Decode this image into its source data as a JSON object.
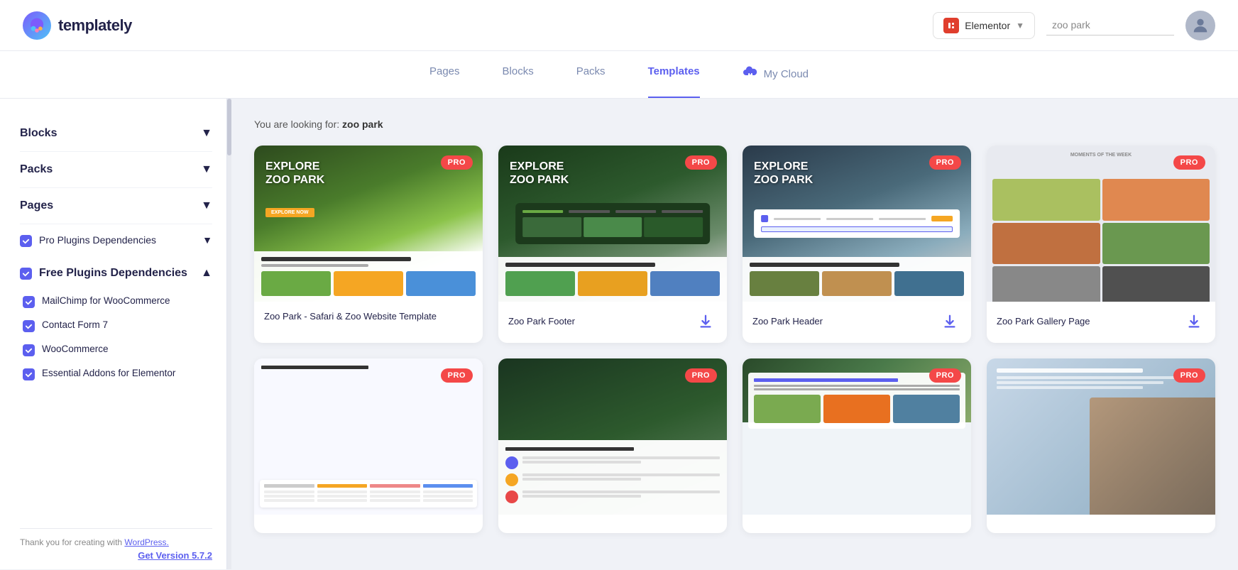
{
  "app": {
    "name": "templately",
    "logo_alt": "Templately logo"
  },
  "header": {
    "builder_label": "Elementor",
    "search_placeholder": "zoo park",
    "search_value": "zoo park"
  },
  "nav": {
    "tabs": [
      {
        "id": "pages",
        "label": "Pages",
        "active": false
      },
      {
        "id": "blocks",
        "label": "Blocks",
        "active": false
      },
      {
        "id": "packs",
        "label": "Packs",
        "active": false
      },
      {
        "id": "templates",
        "label": "Templates",
        "active": true
      },
      {
        "id": "my-cloud",
        "label": "My Cloud",
        "active": false,
        "has_icon": true
      }
    ]
  },
  "sidebar": {
    "filters": [
      {
        "id": "blocks",
        "label": "Blocks",
        "expanded": false
      },
      {
        "id": "packs",
        "label": "Packs",
        "expanded": false
      },
      {
        "id": "pages",
        "label": "Pages",
        "expanded": false
      }
    ],
    "pro_plugins": {
      "label": "Pro Plugins Dependencies",
      "checked": true
    },
    "free_plugins": {
      "label": "Free Plugins Dependencies",
      "checked": true,
      "expanded": true,
      "items": [
        {
          "label": "MailChimp for WooCommerce",
          "checked": true
        },
        {
          "label": "Contact Form 7",
          "checked": true
        },
        {
          "label": "WooCommerce",
          "checked": true
        },
        {
          "label": "Essential Addons for Elementor",
          "checked": true
        }
      ]
    },
    "footer_text": "Thank you for creating with",
    "footer_link_text": "WordPress.",
    "get_version": "Get Version 5.7.2"
  },
  "content": {
    "looking_for_prefix": "You are looking for:",
    "looking_for_query": "zoo park",
    "templates": [
      {
        "id": 1,
        "name": "Zoo Park - Safari & Zoo Website Template",
        "pro": true,
        "has_download": false,
        "thumb_type": "zoo-safari"
      },
      {
        "id": 2,
        "name": "Zoo Park Footer",
        "pro": true,
        "has_download": true,
        "thumb_type": "zoo-footer"
      },
      {
        "id": 3,
        "name": "Zoo Park Header",
        "pro": true,
        "has_download": true,
        "thumb_type": "zoo-header"
      },
      {
        "id": 4,
        "name": "Zoo Park Gallery Page",
        "pro": true,
        "has_download": true,
        "thumb_type": "zoo-gallery"
      },
      {
        "id": 5,
        "name": "",
        "pro": true,
        "has_download": false,
        "thumb_type": "zoo-membership"
      },
      {
        "id": 6,
        "name": "",
        "pro": true,
        "has_download": false,
        "thumb_type": "zoo-tickets"
      },
      {
        "id": 7,
        "name": "",
        "pro": true,
        "has_download": false,
        "thumb_type": "zoo-events"
      },
      {
        "id": 8,
        "name": "",
        "pro": true,
        "has_download": false,
        "thumb_type": "zoo-family"
      }
    ]
  },
  "icons": {
    "chevron_down": "▼",
    "chevron_up": "▲",
    "checkmark": "✓",
    "download": "⬇",
    "cloud": "☁"
  },
  "colors": {
    "accent": "#5c5fef",
    "pro_badge": "#f44848",
    "text_primary": "#23234a",
    "text_secondary": "#7b8ab0"
  }
}
